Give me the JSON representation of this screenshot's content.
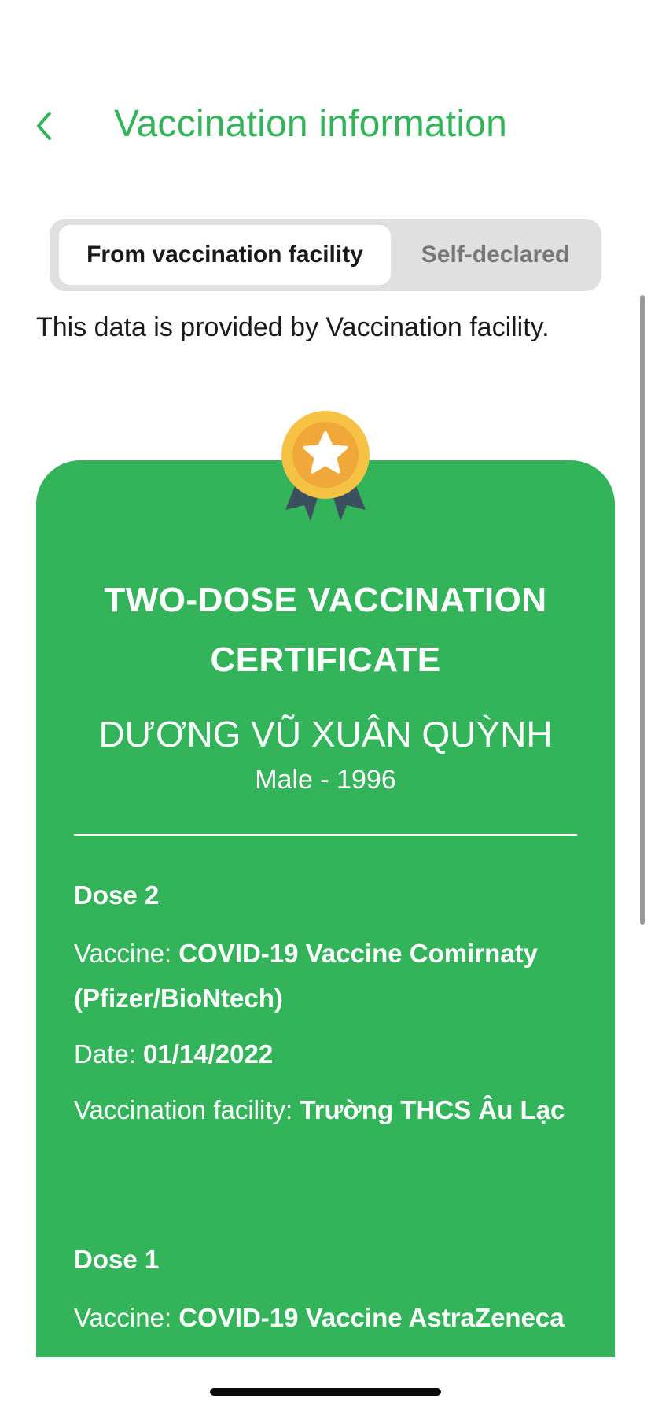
{
  "header": {
    "title": "Vaccination information",
    "back_icon": "chevron-left-icon"
  },
  "tabs": [
    {
      "label": "From vaccination facility",
      "active": true
    },
    {
      "label": "Self-declared",
      "active": false
    }
  ],
  "note": "This data is provided by Vaccination facility.",
  "certificate": {
    "title": "TWO-DOSE VACCINATION CERTIFICATE",
    "badge_icon": "star-medal-icon",
    "holder_name": "DƯƠNG VŨ XUÂN QUỲNH",
    "holder_meta": "Male - 1996",
    "doses": [
      {
        "heading": "Dose 2",
        "vaccine_label": "Vaccine: ",
        "vaccine": "COVID-19 Vaccine Comirnaty (Pfizer/BioNtech)",
        "date_label": "Date: ",
        "date": "01/14/2022",
        "facility_label": "Vaccination facility: ",
        "facility": "Trường THCS Âu Lạc"
      },
      {
        "heading": "Dose 1",
        "vaccine_label": "Vaccine: ",
        "vaccine": "COVID-19 Vaccine AstraZeneca"
      }
    ]
  },
  "colors": {
    "accent": "#33b45b",
    "segment_bg": "#e0e0e0",
    "medal_gold": "#f6c244",
    "medal_ribbon": "#3b4f5f"
  }
}
